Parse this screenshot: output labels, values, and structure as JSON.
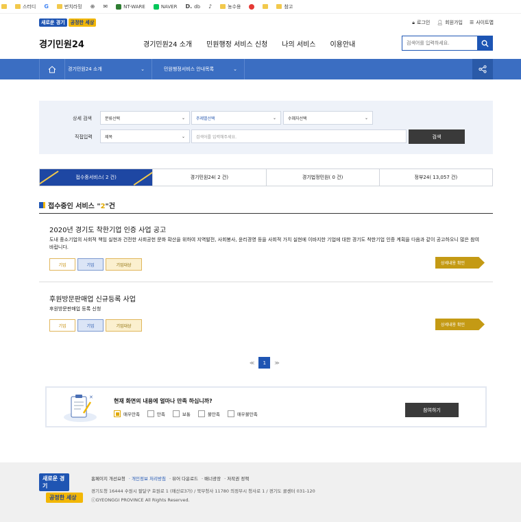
{
  "bookmarks": [
    {
      "label": "",
      "icon": "folder-icon"
    },
    {
      "label": "스터디",
      "icon": "folder-icon"
    },
    {
      "label": "",
      "icon": "google-icon"
    },
    {
      "label": "번치라밍",
      "icon": "folder-icon"
    },
    {
      "label": "",
      "icon": "globe-icon"
    },
    {
      "label": "",
      "icon": "mail-icon"
    },
    {
      "label": "NT-WARE",
      "icon": "site-icon"
    },
    {
      "label": "NAVER",
      "icon": "naver-icon"
    },
    {
      "label": "db",
      "icon": "d-icon"
    },
    {
      "label": "",
      "icon": "tiktok-icon"
    },
    {
      "label": "",
      "icon": "folder-icon"
    },
    {
      "label": "농수용",
      "icon": "folder-icon"
    },
    {
      "label": "",
      "icon": "site-icon"
    },
    {
      "label": "",
      "icon": "folder-icon"
    },
    {
      "label": "참고",
      "icon": "folder-icon"
    }
  ],
  "header": {
    "logo_a": "새로운 경기",
    "logo_b": "공정한 세상",
    "brand": "경기민원24",
    "util": [
      "로그인",
      "회원가입",
      "사이트맵"
    ],
    "gnb": [
      "경기민원24 소개",
      "민원행정 서비스 신청",
      "나의 서비스",
      "이용안내"
    ],
    "search_placeholder": "검색어를 입력하세요."
  },
  "subnav": {
    "menu1": "경기민원24 소개",
    "menu2": "민원행정서비스 안내목록"
  },
  "filter": {
    "label1": "상세 검색",
    "label2": "직접입력",
    "select1": "분류선택",
    "select2": "주제별선택",
    "select3": "수혜자선택",
    "select4": "제목",
    "keyword_placeholder": "검색어를 입력해주세요.",
    "search_button": "검색"
  },
  "tabs": [
    "접수중서비스( 2 건)",
    "경기민원24( 2 건)",
    "경기법정민원( 0 건)",
    "정부24( 13,057 건)"
  ],
  "section": {
    "prefix": "접수중인 서비스 \"",
    "count": "2",
    "suffix": "\"건"
  },
  "items": [
    {
      "title": "2020년 경기도 착한기업 인증 사업 공고",
      "desc": "도내 중소기업의 사회적 책임 실현과 건전한 사회공헌 문화 확산을 위하여 지역발전, 사회봉사, 윤리경영 등을 사회적 가치 실현에 이바지한 기업에 대한 경기도 착한기업 인증 계획을 다음과 같이 공고하오니 많은 참여 바랍니다.",
      "tags": [
        "기업",
        "기업",
        "기업대상"
      ],
      "more": "상세내용 확인"
    },
    {
      "title": "후원방문판매업 신규등록 사업",
      "desc": "후원방문판매업 등록 신청",
      "tags": [
        "기업",
        "기업",
        "기업대상"
      ],
      "more": "상세내용 확인"
    }
  ],
  "pagination": {
    "prev": "≪",
    "current": "1",
    "next": "≫"
  },
  "survey": {
    "question": "현재 화면의 내용에 얼마나 만족 하십니까?",
    "options": [
      "매우만족",
      "만족",
      "보통",
      "불만족",
      "매우불만족"
    ],
    "selected": "매우만족",
    "button": "참여하기"
  },
  "footer": {
    "logo_a": "새로운 경기",
    "logo_b": "공정한 세상",
    "links": [
      "홈페이지 개선요청",
      "· 개인정보 처리방침",
      "· 뷰어 다운로드",
      "· 배너광장",
      "· 저작권 정책"
    ],
    "address": "경기도청 16444 수원시 팔달구 효원로 1 (매산로3가) / 북부청사 11780 의정부시 청사로 1 / 경기도 콜센터 031-120",
    "copyright": "ⓒGYEONGGI PROVINCE All Rights Reserved."
  },
  "colors": {
    "primary": "#1f55b3",
    "nav": "#3b6ec2",
    "accent": "#f2b705",
    "more": "#c49a14"
  }
}
